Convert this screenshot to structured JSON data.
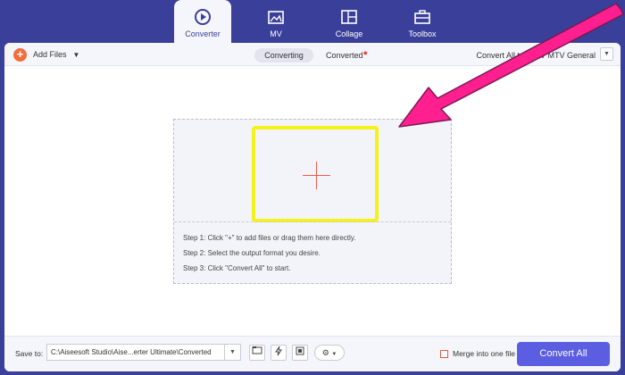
{
  "nav": {
    "tabs": [
      {
        "label": "Converter",
        "icon": "converter-icon",
        "active": true
      },
      {
        "label": "MV",
        "icon": "mv-icon",
        "active": false
      },
      {
        "label": "Collage",
        "icon": "collage-icon",
        "active": false
      },
      {
        "label": "Toolbox",
        "icon": "toolbox-icon",
        "active": false
      }
    ]
  },
  "toolbar": {
    "add_files": "Add Files",
    "converting": "Converting",
    "converted": "Converted",
    "convert_all_to": "Convert All to: MTV MTV General"
  },
  "dropzone": {
    "steps": [
      "Step 1: Click \"+\" to add files or drag them here directly.",
      "Step 2: Select the output format you desire.",
      "Step 3: Click \"Convert All\" to start."
    ]
  },
  "bottom": {
    "save_to_label": "Save to:",
    "save_path": "C:\\Aiseesoft Studio\\Aise...erter Ultimate\\Converted",
    "merge_label": "Merge into one file",
    "convert_all_button": "Convert All"
  },
  "colors": {
    "background": "#3a3f9a",
    "accent": "#5b5ee0",
    "highlight_box": "#f6f117",
    "arrow": "#ff1f8f",
    "add_icon": "#f26b3a"
  }
}
